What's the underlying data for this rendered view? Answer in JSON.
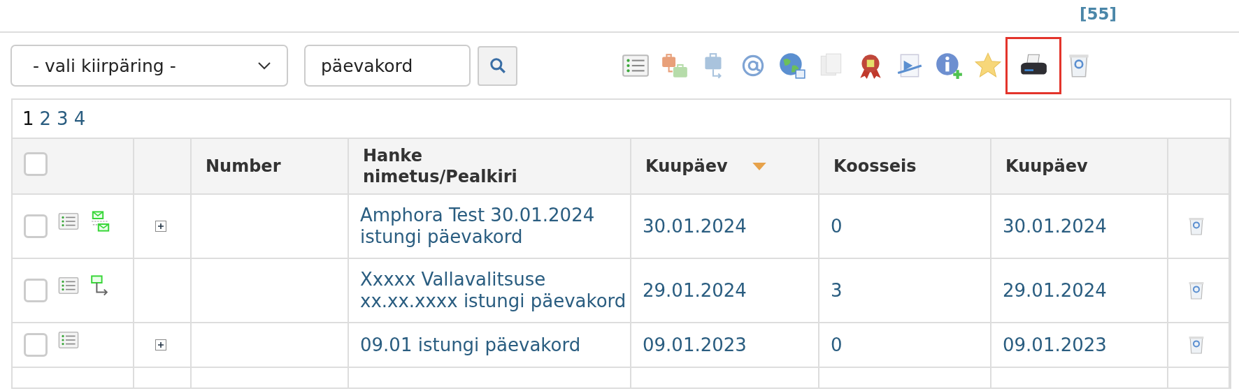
{
  "counter": "[55]",
  "quick_query": {
    "value": "- vali kiirpäring -"
  },
  "search": {
    "value": "päevakord"
  },
  "toolbar": [
    {
      "kind": "list",
      "highlighted": false
    },
    {
      "kind": "briefcases",
      "highlighted": false
    },
    {
      "kind": "briefcase",
      "highlighted": false
    },
    {
      "kind": "at",
      "highlighted": false
    },
    {
      "kind": "globe",
      "highlighted": false
    },
    {
      "kind": "documents",
      "highlighted": false
    },
    {
      "kind": "ribbon",
      "highlighted": false
    },
    {
      "kind": "send",
      "highlighted": false
    },
    {
      "kind": "info",
      "highlighted": false
    },
    {
      "kind": "star",
      "highlighted": false
    },
    {
      "kind": "printer",
      "highlighted": true
    },
    {
      "kind": "trash",
      "highlighted": false
    }
  ],
  "pages": [
    {
      "label": "1",
      "selected": true
    },
    {
      "label": "2",
      "selected": false
    },
    {
      "label": "3",
      "selected": false
    },
    {
      "label": "4",
      "selected": false
    }
  ],
  "columns": [
    {
      "kind": "checkbox",
      "checked": false
    },
    {
      "kind": "blank"
    },
    {
      "kind": "text",
      "label": "Number"
    },
    {
      "kind": "text",
      "label": "Hanke nimetus/Pealkiri"
    },
    {
      "kind": "text",
      "label": "Kuupäev",
      "sorted": true
    },
    {
      "kind": "text",
      "label": "Koosseis"
    },
    {
      "kind": "text",
      "label": "Kuupäev"
    },
    {
      "kind": "blank"
    }
  ],
  "rows": [
    {
      "checked": false,
      "actions": [
        {
          "kind": "list"
        },
        {
          "kind": "envelopes"
        }
      ],
      "expandable": true,
      "title": "Amphora Test 30.01.2024 istungi päevakord",
      "date": "30.01.2024",
      "members": "0",
      "date_2": "30.01.2024"
    },
    {
      "checked": false,
      "actions": [
        {
          "kind": "list"
        },
        {
          "kind": "node-arrow"
        }
      ],
      "expandable": false,
      "title": "Xxxxx Vallavalitsuse xx.xx.xxxx istungi päevakord",
      "date": "29.01.2024",
      "members": "3",
      "date_2": "29.01.2024"
    },
    {
      "checked": false,
      "actions": [
        {
          "kind": "list"
        }
      ],
      "expandable": true,
      "title": "09.01 istungi päevakord",
      "date": "09.01.2023",
      "members": "0",
      "date_2": "09.01.2023"
    }
  ]
}
